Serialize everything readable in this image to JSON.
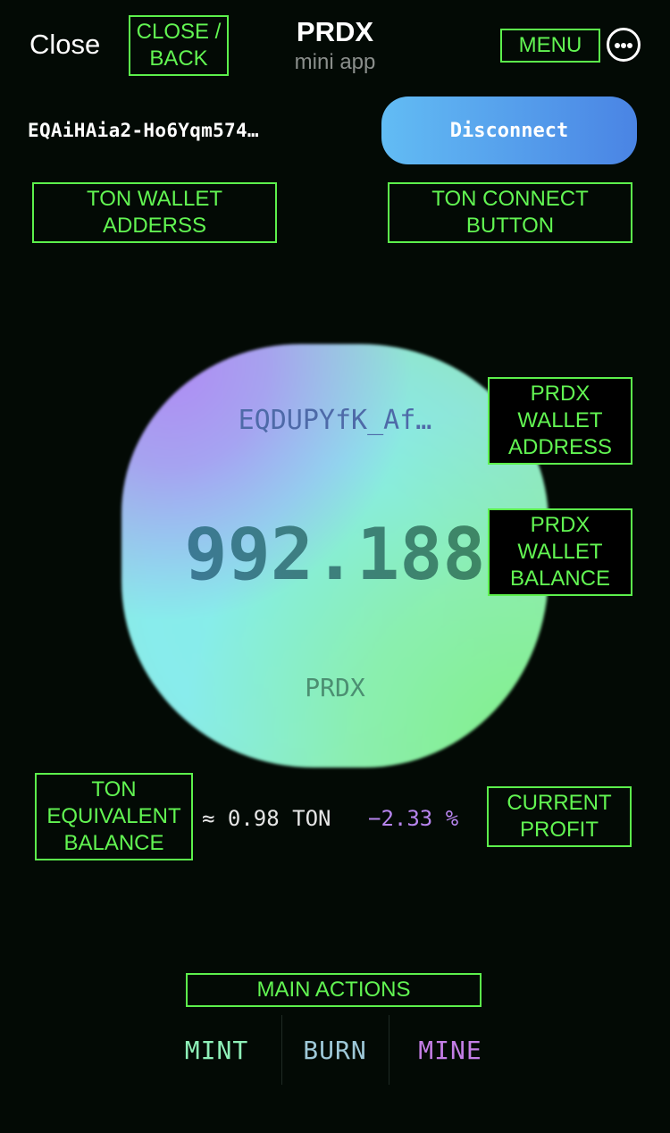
{
  "header": {
    "close_label": "Close",
    "title": "PRDX",
    "subtitle": "mini app",
    "more_icon": "ellipsis-circle-icon"
  },
  "wallet": {
    "ton_address": "EQAiHAia2-Ho6Yqm574…",
    "disconnect_label": "Disconnect"
  },
  "prdx": {
    "address": "EQDUPYfK_Af…",
    "balance": "992.188",
    "unit": "PRDX"
  },
  "ton_equivalent": {
    "value": "≈ 0.98 TON",
    "profit": "−2.33 %"
  },
  "actions": [
    {
      "label": "MINT",
      "color": "#8ef0b8"
    },
    {
      "label": "BURN",
      "color": "#9ec8d8"
    },
    {
      "label": "MINE",
      "color": "#c47ee6"
    }
  ],
  "annotations": {
    "close_back": "CLOSE /\nBACK",
    "menu": "MENU",
    "ton_wallet_address": "TON WALLET\nADDERSS",
    "ton_connect_button": "TON CONNECT\nBUTTON",
    "prdx_wallet_address": "PRDX\nWALLET\nADDRESS",
    "prdx_wallet_balance": "PRDX\nWALLET\nBALANCE",
    "ton_equivalent_balance": "TON\nEQUIVALENT\nBALANCE",
    "current_profit": "CURRENT\nPROFIT",
    "main_actions": "MAIN ACTIONS"
  },
  "colors": {
    "background": "#030a05",
    "annotation": "#5cf04c",
    "disconnect_gradient": [
      "#62bcf4",
      "#4a84e4"
    ],
    "profit": "#b785ee"
  }
}
